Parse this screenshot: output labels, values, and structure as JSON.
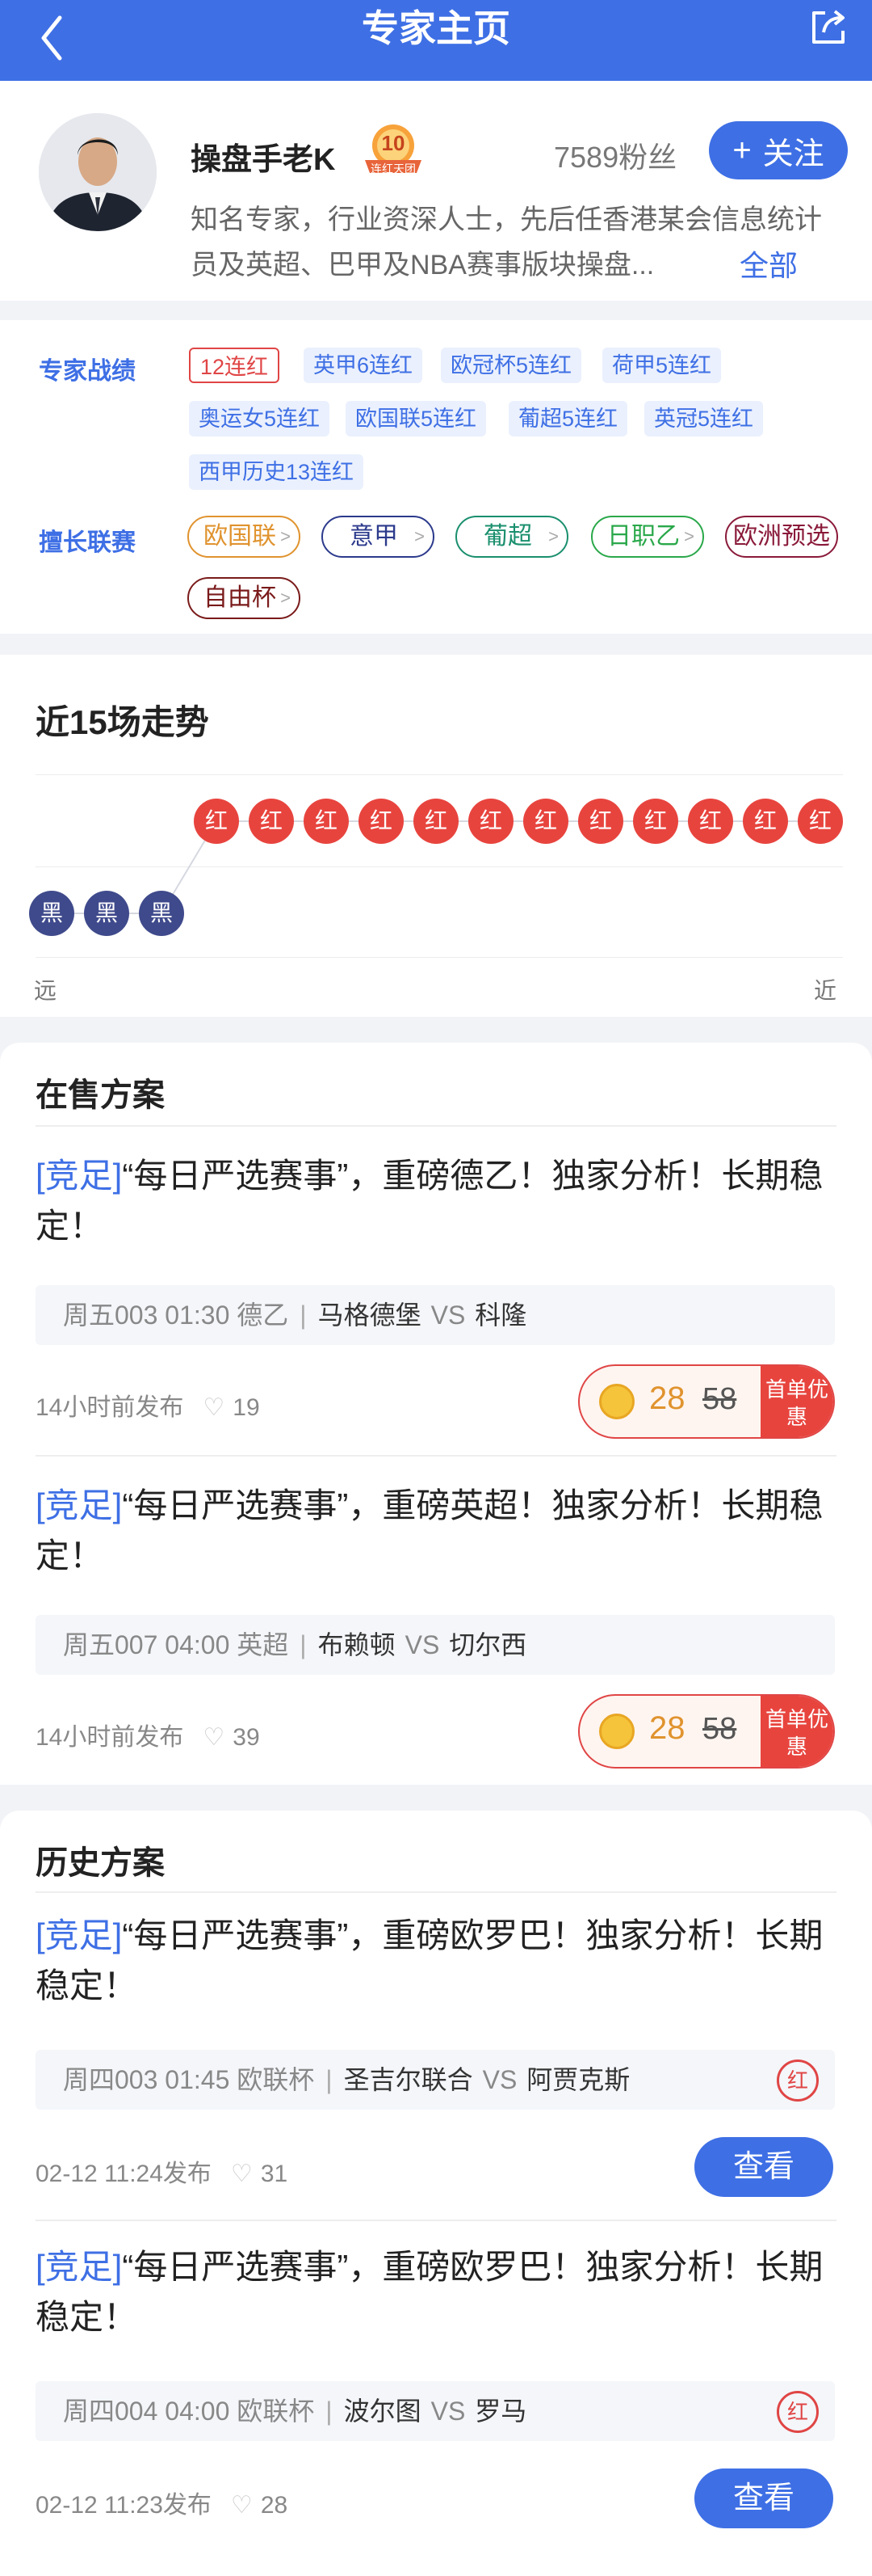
{
  "header": {
    "title": "专家主页",
    "back_icon": "chevron-left-icon",
    "share_icon": "share-icon"
  },
  "profile": {
    "name": "操盘手老K",
    "badge_number": "10",
    "badge_text": "连红天团",
    "fans": "7589粉丝",
    "follow_label": "关注",
    "intro": "知名专家，行业资深人士，先后任香港某会信息统计员及英超、巴甲及NBA赛事版块操盘...",
    "intro_more": "全部"
  },
  "records": {
    "label": "专家战绩",
    "tags": [
      "12连红",
      "英甲6连红",
      "欧冠杯5连红",
      "荷甲5连红",
      "奥运女5连红",
      "欧国联5连红",
      "葡超5连红",
      "英冠5连红",
      "西甲历史13连红"
    ]
  },
  "leagues": {
    "label": "擅长联赛",
    "items": [
      {
        "name": "欧国联",
        "color": "#e0932e"
      },
      {
        "name": "意甲",
        "color": "#2c3a8c"
      },
      {
        "name": "葡超",
        "color": "#1a8f6e"
      },
      {
        "name": "日职乙",
        "color": "#2aa84a"
      },
      {
        "name": "欧洲预选",
        "color": "#8a1a3a"
      },
      {
        "name": "自由杯",
        "color": "#7a1a1a"
      }
    ]
  },
  "trend": {
    "title": "近15场走势",
    "results": [
      "黑",
      "黑",
      "黑",
      "红",
      "红",
      "红",
      "红",
      "红",
      "红",
      "红",
      "红",
      "红",
      "红",
      "红",
      "红"
    ],
    "far_label": "远",
    "near_label": "近",
    "colors": {
      "red": "#e8443e",
      "black": "#3f4a8c"
    }
  },
  "on_sale": {
    "title": "在售方案",
    "plans": [
      {
        "kind": "[竞足]",
        "title": "“每日严选赛事”，重磅德乙！独家分析！长期稳定！",
        "meta": "周五003 01:30 德乙",
        "home": "马格德堡",
        "vs": "VS",
        "away": "科隆",
        "published": "14小时前发布",
        "likes": "19",
        "price_now": "28",
        "price_old": "58",
        "promo": "首单优惠"
      },
      {
        "kind": "[竞足]",
        "title": "“每日严选赛事”，重磅英超！独家分析！长期稳定！",
        "meta": "周五007 04:00 英超",
        "home": "布赖顿",
        "vs": "VS",
        "away": "切尔西",
        "published": "14小时前发布",
        "likes": "39",
        "price_now": "28",
        "price_old": "58",
        "promo": "首单优惠"
      }
    ]
  },
  "history": {
    "title": "历史方案",
    "plans": [
      {
        "kind": "[竞足]",
        "title": "“每日严选赛事”，重磅欧罗巴！独家分析！长期稳定！",
        "meta": "周四003 01:45 欧联杯",
        "home": "圣吉尔联合",
        "vs": "VS",
        "away": "阿贾克斯",
        "result": "红",
        "published": "02-12 11:24发布",
        "likes": "31",
        "button": "查看"
      },
      {
        "kind": "[竞足]",
        "title": "“每日严选赛事”，重磅欧罗巴！独家分析！长期稳定！",
        "meta": "周四004 04:00 欧联杯",
        "home": "波尔图",
        "vs": "VS",
        "away": "罗马",
        "result": "红",
        "published": "02-12 11:23发布",
        "likes": "28",
        "button": "查看"
      }
    ]
  }
}
